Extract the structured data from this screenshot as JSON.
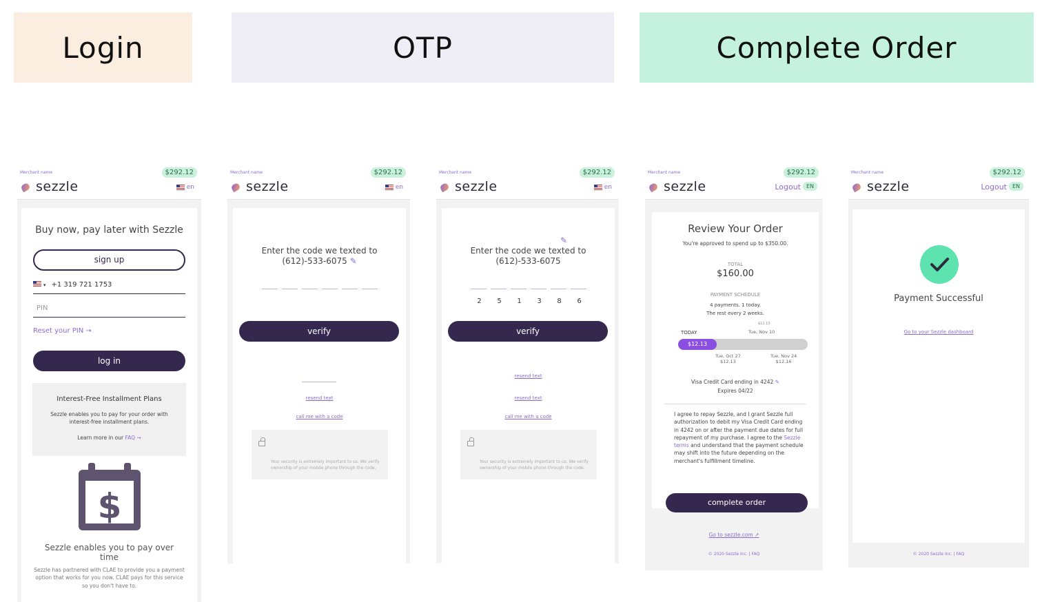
{
  "banners": {
    "login": "Login",
    "otp": "OTP",
    "complete": "Complete Order"
  },
  "common": {
    "merchant": "Merchant name",
    "price": "$292.12",
    "logo": "sezzle",
    "lang": "en",
    "logout": "Logout",
    "lang_badge": "EN"
  },
  "login": {
    "title": "Buy now, pay later with Sezzle",
    "signup": "sign up",
    "phone": "+1 319 721 1753",
    "pin_placeholder": "PIN",
    "reset": "Reset your PIN →",
    "login_button": "log in",
    "info_title": "Interest-Free Installment Plans",
    "info_body": "Sezzle enables you to pay for your order with interest-free installment plans.",
    "learn_prefix": "Learn more in our",
    "learn_link": "FAQ →",
    "promo_title": "Sezzle enables you to pay over time",
    "promo_body": "Sezzle has partnered with CLAE to provide you a payment option that works for you now. CLAE pays for this service so you don't have to."
  },
  "otp": {
    "prompt": "Enter the code we texted to",
    "phone": "(612)-533-6075",
    "verify": "verify",
    "resend": "resend text",
    "call": "call me with a code",
    "security": "Your security is extremely important to us. We verify ownership of your mobile phone through the code.",
    "digits": [
      "2",
      "5",
      "1",
      "3",
      "8",
      "6"
    ]
  },
  "review": {
    "title": "Review Your Order",
    "approved": "You're approved to spend up to $350.00.",
    "total_label": "TOTAL",
    "total": "$160.00",
    "schedule_label": "PAYMENT SCHEDULE",
    "schedule_line1": "4 payments. 1 today.",
    "schedule_line2": "The rest every 2 weeks.",
    "today": "TODAY",
    "today_amount": "$12.13",
    "p2_amount": "$12.13",
    "p2_date": "Tue, Nov 10",
    "p3_date": "Tue, Oct 27",
    "p3_amount": "$12.13",
    "p4_date": "Tue, Nov 24",
    "p4_amount": "$12.16",
    "card": "Visa Credit Card ending in 4242",
    "expires": "Expires 04/22",
    "terms_pre": "I agree to repay Sezzle, and I grant Sezzle full authorization to debit my Visa Credit Card ending in 4242 on or after the payment due dates for full repayment of my purchase. I agree to the",
    "terms_link": "Sezzle terms",
    "terms_post": "and understand that the payment schedule may shift into the future depending on the merchant's fulfillment timeline.",
    "complete": "complete order",
    "goto": "Go to sezzle.com",
    "footer": "© 2020 Sezzle Inc.  |  FAQ"
  },
  "success": {
    "title": "Payment Successful",
    "dashboard": "Go to your Sezzle dashboard",
    "footer": "© 2020 Sezzle Inc.  |  FAQ"
  },
  "colors": {
    "brand_dark": "#35284f",
    "accent_purple": "#8a6bd1",
    "success_green": "#5ee3b0"
  }
}
